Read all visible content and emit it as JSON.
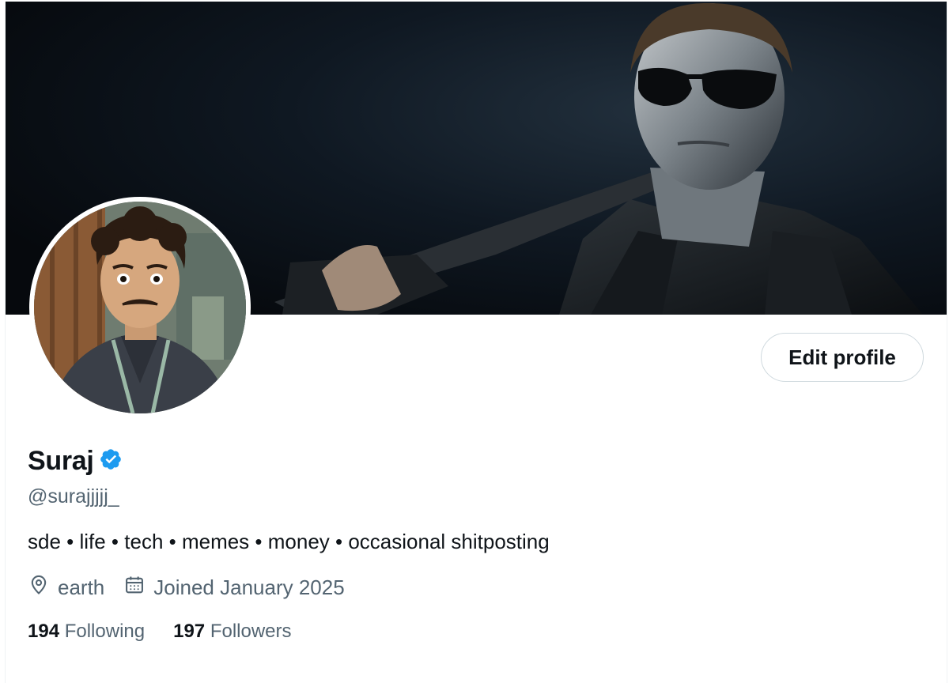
{
  "profile": {
    "name": "Suraj",
    "handle": "@surajjjjj_",
    "bio": "sde • life • tech • memes • money • occasional shitposting",
    "location": "earth",
    "joined": "Joined January 2025",
    "verified": true,
    "following_count": "194",
    "following_label": "Following",
    "followers_count": "197",
    "followers_label": "Followers"
  },
  "actions": {
    "edit_profile_label": "Edit profile"
  },
  "icons": {
    "verified": "verified-badge-icon",
    "location": "location-pin-icon",
    "calendar": "calendar-icon"
  },
  "colors": {
    "verified": "#1d9bf0",
    "text_primary": "#0f1419",
    "text_secondary": "#536471",
    "button_border": "#cfd9de"
  }
}
